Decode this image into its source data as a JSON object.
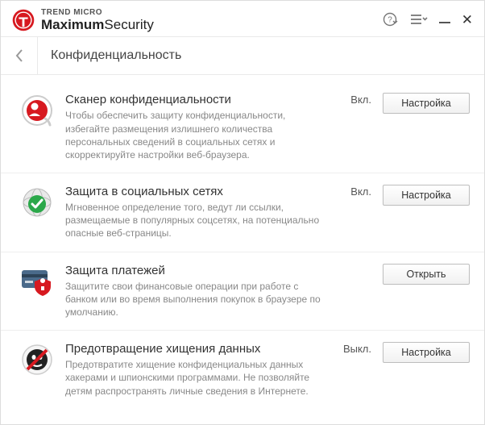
{
  "brand": {
    "top": "TREND MICRO",
    "bold": "Maximum",
    "light": "Security"
  },
  "page_title": "Конфиденциальность",
  "rows": [
    {
      "title": "Сканер конфиденциальности",
      "state": "Вкл.",
      "desc": "Чтобы обеспечить защиту конфиденциальности, избегайте размещения излишнего количества персональных сведений в социальных сетях и скорректируйте настройки веб-браузера.",
      "button": "Настройка"
    },
    {
      "title": "Защита в социальных сетях",
      "state": "Вкл.",
      "desc": "Мгновенное определение того, ведут ли ссылки, размещаемые в популярных соцсетях, на потенциально опасные веб-страницы.",
      "button": "Настройка"
    },
    {
      "title": "Защита платежей",
      "state": "",
      "desc": "Защитите свои финансовые операции при работе с банком или во время выполнения покупок в браузере по умолчанию.",
      "button": "Открыть"
    },
    {
      "title": "Предотвращение хищения данных",
      "state": "Выкл.",
      "desc": "Предотвратите хищение конфиденциальных данных хакерами и шпионскими программами. Не позволяйте детям распространять личные сведения в Интернете.",
      "button": "Настройка"
    }
  ]
}
